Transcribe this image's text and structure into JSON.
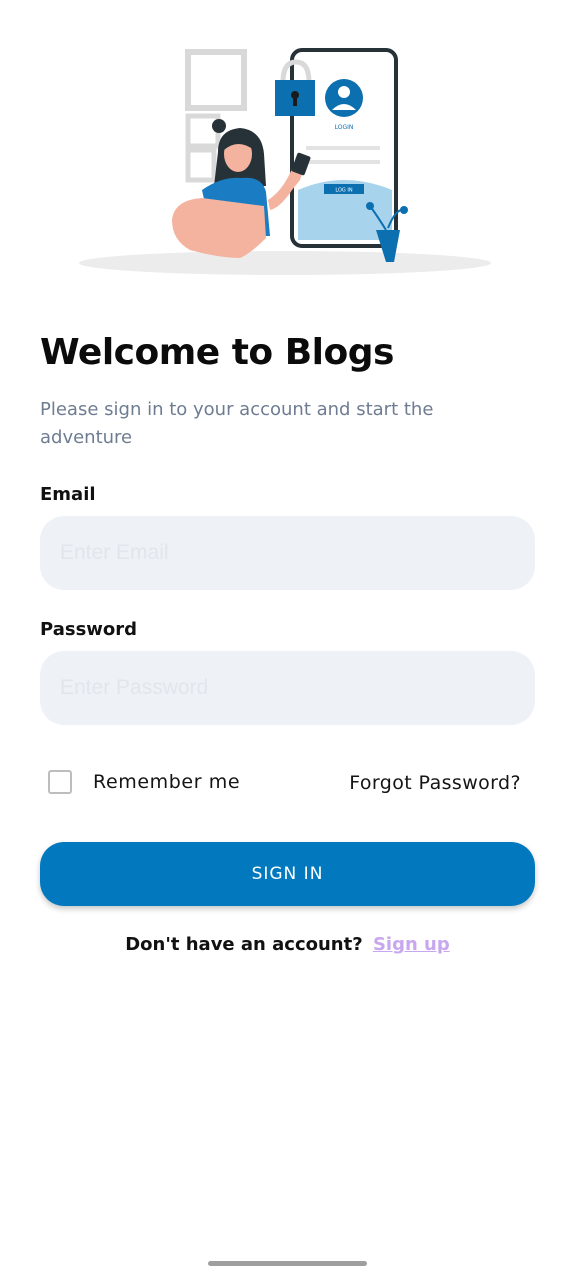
{
  "illustration": {
    "phone_login_label": "LOGIN",
    "phone_button_label": "LOG IN"
  },
  "header": {
    "title": "Welcome to Blogs",
    "subtitle": "Please sign in to your account and start the adventure"
  },
  "form": {
    "email_label": "Email",
    "email_placeholder": "Enter Email",
    "email_value": "",
    "password_label": "Password",
    "password_placeholder": "Enter Password",
    "password_value": "",
    "remember_label": "Remember me",
    "remember_checked": false,
    "forgot_label": "Forgot Password?",
    "signin_label": "SIGN IN"
  },
  "footer": {
    "signup_prompt": "Don't have an account?",
    "signup_link": "Sign up"
  },
  "colors": {
    "primary": "#0279be",
    "input_bg": "#eef2f7",
    "subtitle": "#6e7c92",
    "link": "#c8a7ef"
  }
}
